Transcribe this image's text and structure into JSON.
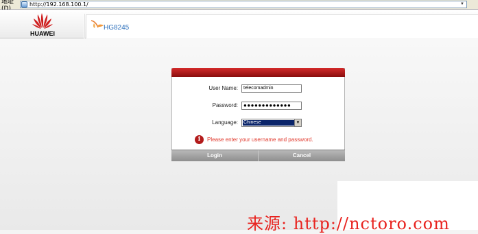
{
  "address_bar": {
    "label": "地址(D)",
    "url": "http://192.168.100.1/"
  },
  "header": {
    "brand": "HUAWEI",
    "model": "HG8245"
  },
  "login": {
    "username_label": "User Name:",
    "username_value": "telecomadmin",
    "password_label": "Password:",
    "password_value": "●●●●●●●●●●●●●",
    "language_label": "Language:",
    "language_value": "Chinese",
    "error_icon": "i",
    "error_text": "Please enter your username and password.",
    "login_button": "Login",
    "cancel_button": "Cancel"
  },
  "colors": {
    "brand_red": "#cf1f1f",
    "error_text": "#e03a2e",
    "model_text": "#2a6ebb"
  },
  "watermark": "来源: http://nctoro.com"
}
